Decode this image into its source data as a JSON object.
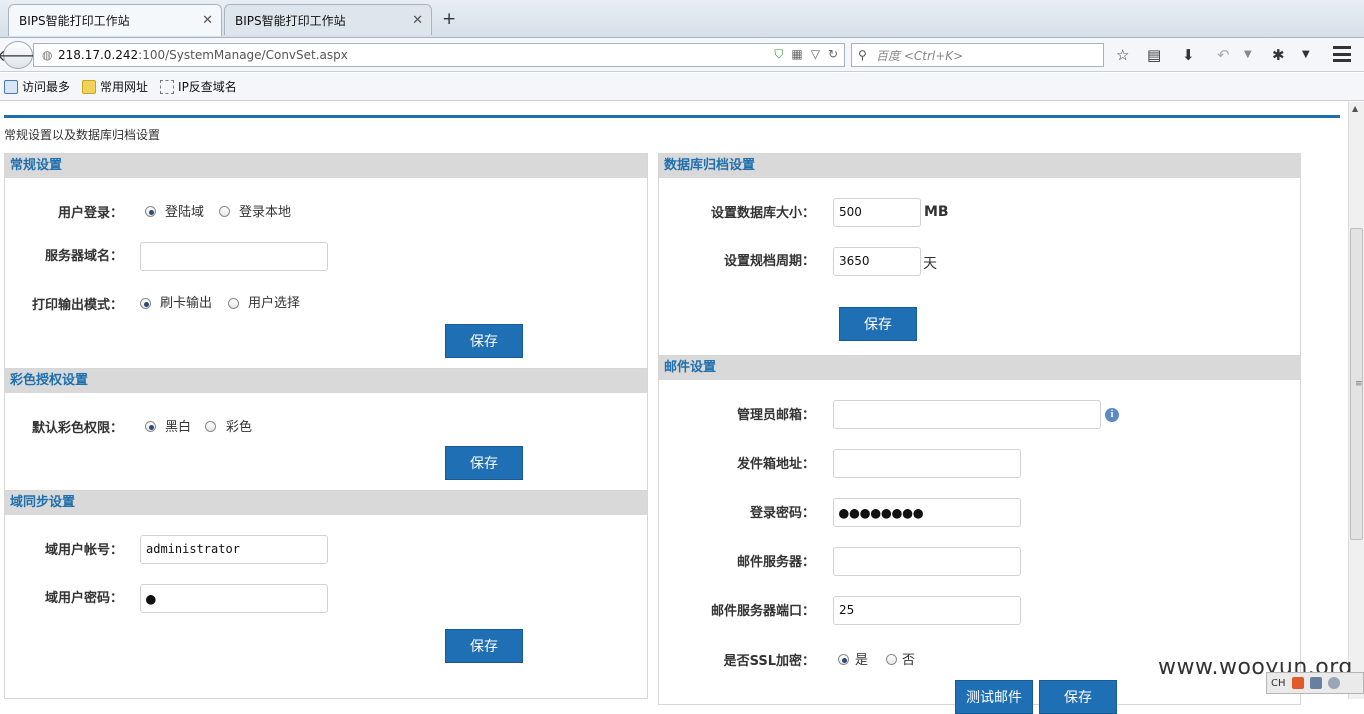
{
  "browser": {
    "tabs": [
      {
        "title": "BIPS智能打印工作站"
      },
      {
        "title": "BIPS智能打印工作站"
      }
    ],
    "url_host": "218.17.0.242",
    "url_path": ":100/SystemManage/ConvSet.aspx",
    "search_placeholder": "百度 <Ctrl+K>",
    "bookmarks": [
      "访问最多",
      "常用网址",
      "IP反查域名"
    ]
  },
  "page": {
    "title": "常规设置以及数据库归档设置"
  },
  "general": {
    "heading": "常规设置",
    "login_label": "用户登录：",
    "login_options": [
      "登陆域",
      "登录本地"
    ],
    "server_domain_label": "服务器域名：",
    "server_domain_value": "",
    "print_mode_label": "打印输出模式：",
    "print_mode_options": [
      "刷卡输出",
      "用户选择"
    ],
    "save_label": "保存"
  },
  "color": {
    "heading": "彩色授权设置",
    "default_label": "默认彩色权限：",
    "options": [
      "黑白",
      "彩色"
    ],
    "save_label": "保存"
  },
  "domain_sync": {
    "heading": "域同步设置",
    "account_label": "域用户帐号：",
    "account_value": "administrator",
    "password_label": "域用户密码：",
    "password_value": "●",
    "save_label": "保存"
  },
  "archive": {
    "heading": "数据库归档设置",
    "db_size_label": "设置数据库大小：",
    "db_size_value": "500",
    "db_size_unit": "MB",
    "period_label": "设置规档周期：",
    "period_value": "3650",
    "period_unit": "天",
    "save_label": "保存"
  },
  "mail": {
    "heading": "邮件设置",
    "admin_email_label": "管理员邮箱：",
    "admin_email_value": "",
    "sender_label": "发件箱地址：",
    "sender_value": "",
    "password_label": "登录密码：",
    "password_value": "●●●●●●●●",
    "server_label": "邮件服务器：",
    "server_value": "",
    "port_label": "邮件服务器端口：",
    "port_value": "25",
    "ssl_label": "是否SSL加密：",
    "ssl_options": [
      "是",
      "否"
    ],
    "test_label": "测试邮件",
    "save_label": "保存"
  },
  "watermark": "www.wooyun.org",
  "tray": {
    "lang": "CH"
  }
}
